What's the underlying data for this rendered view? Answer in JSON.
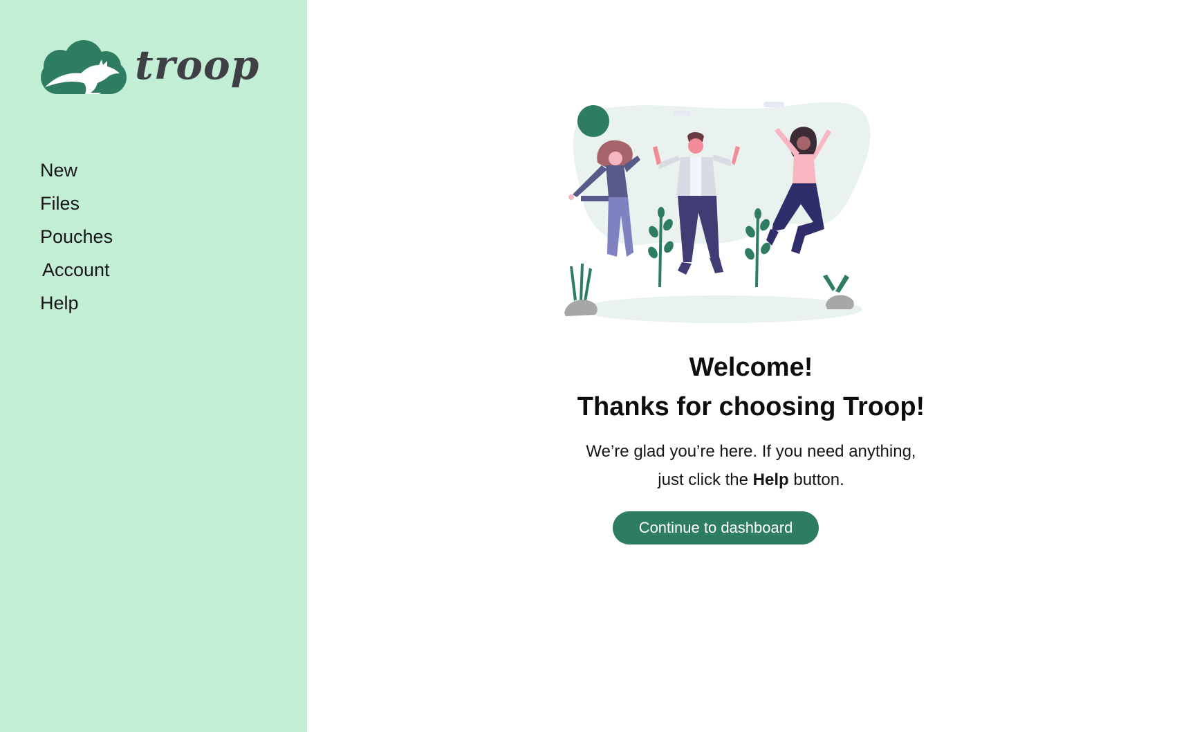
{
  "brand": {
    "name": "troop",
    "accent": "#2e7d62",
    "sidebar_bg": "#c3eed6"
  },
  "sidebar": {
    "items": [
      {
        "label": "New"
      },
      {
        "label": "Files"
      },
      {
        "label": "Pouches"
      },
      {
        "label": "Account"
      },
      {
        "label": "Help"
      }
    ]
  },
  "main": {
    "illustration": "three people jumping with plants",
    "heading": "Welcome!",
    "subheading": "Thanks for choosing Troop!",
    "message_line1": "We’re glad you’re here. If you need anything,",
    "message_line2_prefix": "just click the ",
    "message_line2_bold": "Help",
    "message_line2_suffix": " button.",
    "cta_label": "Continue to dashboard"
  }
}
